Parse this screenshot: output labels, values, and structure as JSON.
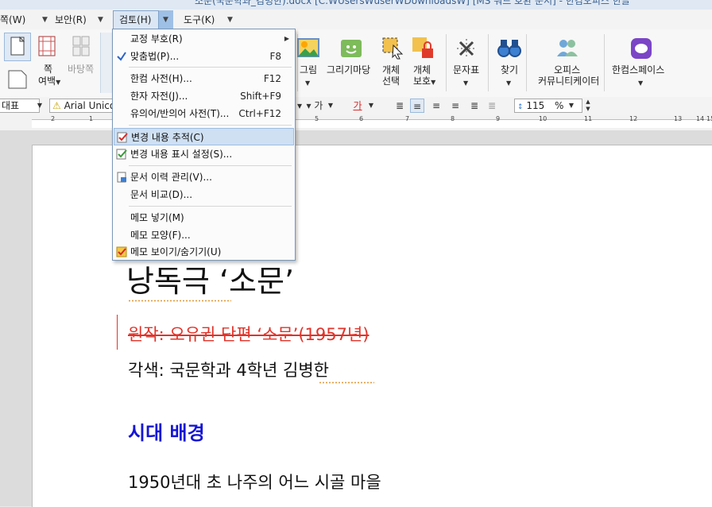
{
  "window": {
    "title": "소문(국문학과_김병한).docx [C:₩Users₩user₩Downloads₩] [MS 워드 호환 문서] - 한컴오피스 한글"
  },
  "menubar": {
    "items": [
      {
        "label": "쪽(W)"
      },
      {
        "label": "보안(R)"
      },
      {
        "label": "검토(H)"
      },
      {
        "label": "도구(K)"
      }
    ]
  },
  "ribbon": {
    "page_label": "쪽",
    "margin_label": "여백",
    "background_label": "바탕쪽",
    "picture_label": "그림",
    "gallery_label": "그리기마당",
    "object_select_label": [
      "개체",
      "선택"
    ],
    "object_protect_label": [
      "개체",
      "보호"
    ],
    "charmap_label": "문자표",
    "find_label": "찾기",
    "office_community_label": [
      "오피스",
      "커뮤니티케이터"
    ],
    "hancom_space_label": "한컴스페이스"
  },
  "formatbar": {
    "style_value": "대표",
    "font_value": "Arial Unico",
    "spacing_value": "115",
    "spacing_unit": "%"
  },
  "ruler": {
    "numbers": [
      "2",
      "1",
      "5",
      "6",
      "7",
      "8",
      "9",
      "10",
      "11",
      "12",
      "13",
      "14",
      "15"
    ]
  },
  "menu": {
    "items": [
      {
        "label": "교정 부호(R)",
        "shortcut": ""
      },
      {
        "label": "맞춤법(P)...",
        "shortcut": "F8"
      },
      {
        "label": "한컴 사전(H)...",
        "shortcut": "F12"
      },
      {
        "label": "한자 자전(J)...",
        "shortcut": "Shift+F9"
      },
      {
        "label": "유의어/반의어 사전(T)...",
        "shortcut": "Ctrl+F12"
      },
      {
        "label": "변경 내용 추적(C)",
        "shortcut": ""
      },
      {
        "label": "변경 내용 표시 설정(S)...",
        "shortcut": ""
      },
      {
        "label": "문서 이력 관리(V)...",
        "shortcut": ""
      },
      {
        "label": "문서 비교(D)...",
        "shortcut": ""
      },
      {
        "label": "메모 넣기(M)",
        "shortcut": ""
      },
      {
        "label": "메모 모양(F)...",
        "shortcut": ""
      },
      {
        "label": "메모 보이기/숨기기(U)",
        "shortcut": ""
      }
    ]
  },
  "document": {
    "title": "낭독극 ‘소문’",
    "original_deleted": "원작: 오유권 단편 ‘소문’(1957년)",
    "adaptation": "각색: 국문학과 4학년 김병한",
    "heading": "시대 배경",
    "setting": "1950년대 초 나주의 어느 시골 마을"
  },
  "colors": {
    "deleted_text": "#e0332a",
    "heading_blue": "#1515d6",
    "menu_highlight": "#cfe0f3"
  }
}
